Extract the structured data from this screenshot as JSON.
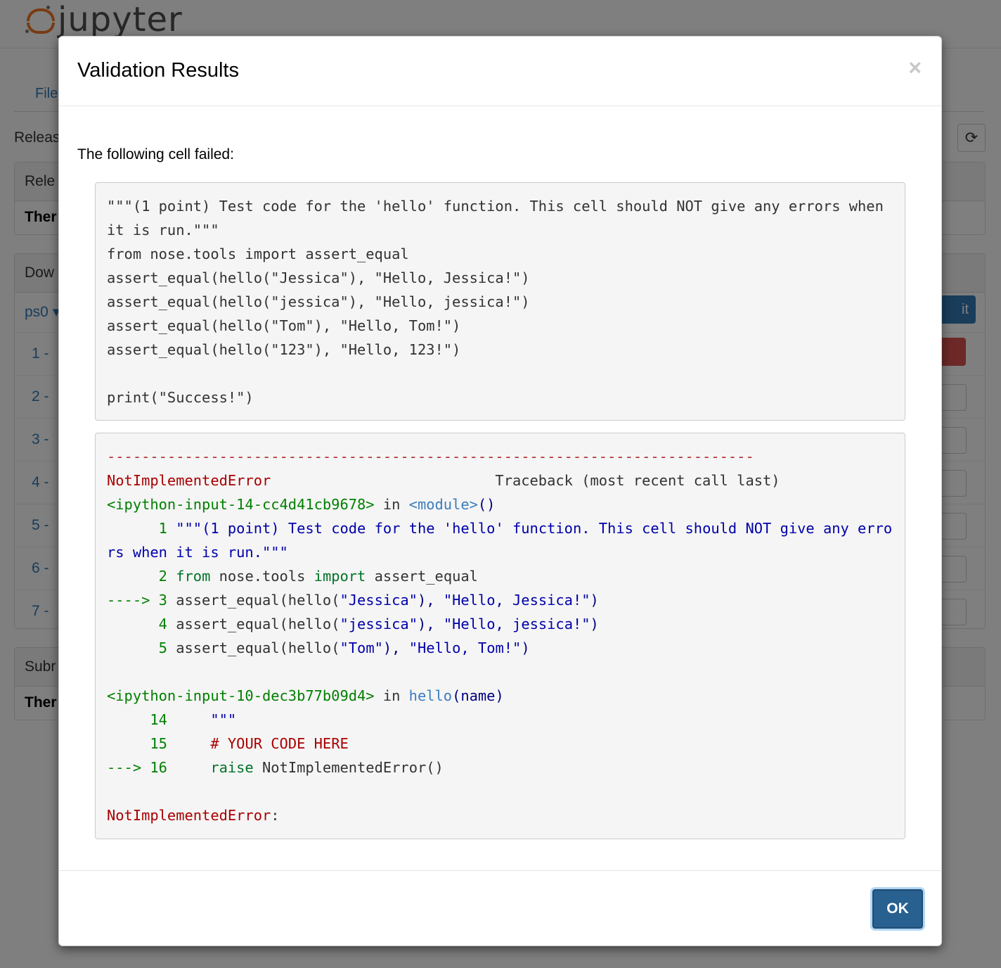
{
  "background": {
    "logo_text": "jupyter",
    "tab_label": "File",
    "release_label": "Releas",
    "panels": [
      {
        "head": "Rele",
        "body": "Ther"
      },
      {
        "head": "Dow"
      },
      {
        "head": "Subr",
        "body": "Ther"
      }
    ],
    "course_select": "ps0 ▾",
    "assignment_rows": [
      "1 -",
      "2 -",
      "3 -",
      "4 -",
      "5 -",
      "6 -",
      "7 -"
    ],
    "submit_button_fragment": "it"
  },
  "modal": {
    "title": "Validation Results",
    "close_label": "×",
    "intro": "The following cell failed:",
    "source_lines": [
      "\"\"\"(1 point) Test code for the 'hello' function. This cell should NOT give any errors when it is run.\"\"\"",
      "from nose.tools import assert_equal",
      "assert_equal(hello(\"Jessica\"), \"Hello, Jessica!\")",
      "assert_equal(hello(\"jessica\"), \"Hello, jessica!\")",
      "assert_equal(hello(\"Tom\"), \"Hello, Tom!\")",
      "assert_equal(hello(\"123\"), \"Hello, 123!\")",
      "",
      "print(\"Success!\")"
    ],
    "traceback": {
      "separator": "---------------------------------------------------------------------------",
      "error_name": "NotImplementedError",
      "traceback_header": "                          Traceback (most recent call last)",
      "frame1": {
        "location": "<ipython-input-14-cc4d41cb9678>",
        "in_word": " in ",
        "func": "<module>",
        "parens": "()",
        "l1_no": "      1 ",
        "l1_code": "\"\"\"(1 point) Test code for the 'hello' function. This cell should NOT give any errors when it is run.\"\"\"",
        "l2_no": "      2 ",
        "l2_from": "from",
        "l2_mod": " nose.tools ",
        "l2_import": "import",
        "l2_rest": " assert_equal",
        "l3_arrow": "----> 3 ",
        "l3_call": "assert_equal(hello(",
        "l3_s1": "\"Jessica\"",
        "l3_mid": "), ",
        "l3_s2": "\"Hello, Jessica!\"",
        "l3_end": ")",
        "l4_no": "      4 ",
        "l4_call": "assert_equal(hello(",
        "l4_s1": "\"jessica\"",
        "l4_mid": "), ",
        "l4_s2": "\"Hello, jessica!\"",
        "l4_end": ")",
        "l5_no": "      5 ",
        "l5_call": "assert_equal(hello(",
        "l5_s1": "\"Tom\"",
        "l5_mid": "), ",
        "l5_s2": "\"Hello, Tom!\"",
        "l5_end": ")"
      },
      "frame2": {
        "location": "<ipython-input-10-dec3b77b09d4>",
        "in_word": " in ",
        "func": "hello",
        "args": "(name)",
        "l14_no": "     14 ",
        "l14_code": "    \"\"\"",
        "l15_no": "     15 ",
        "l15_comment": "    # YOUR CODE HERE",
        "l16_arrow": "---> 16 ",
        "l16_raise": "    raise",
        "l16_rest": " NotImplementedError()"
      },
      "final_error": "NotImplementedError",
      "final_colon": ":"
    },
    "ok_label": "OK"
  }
}
